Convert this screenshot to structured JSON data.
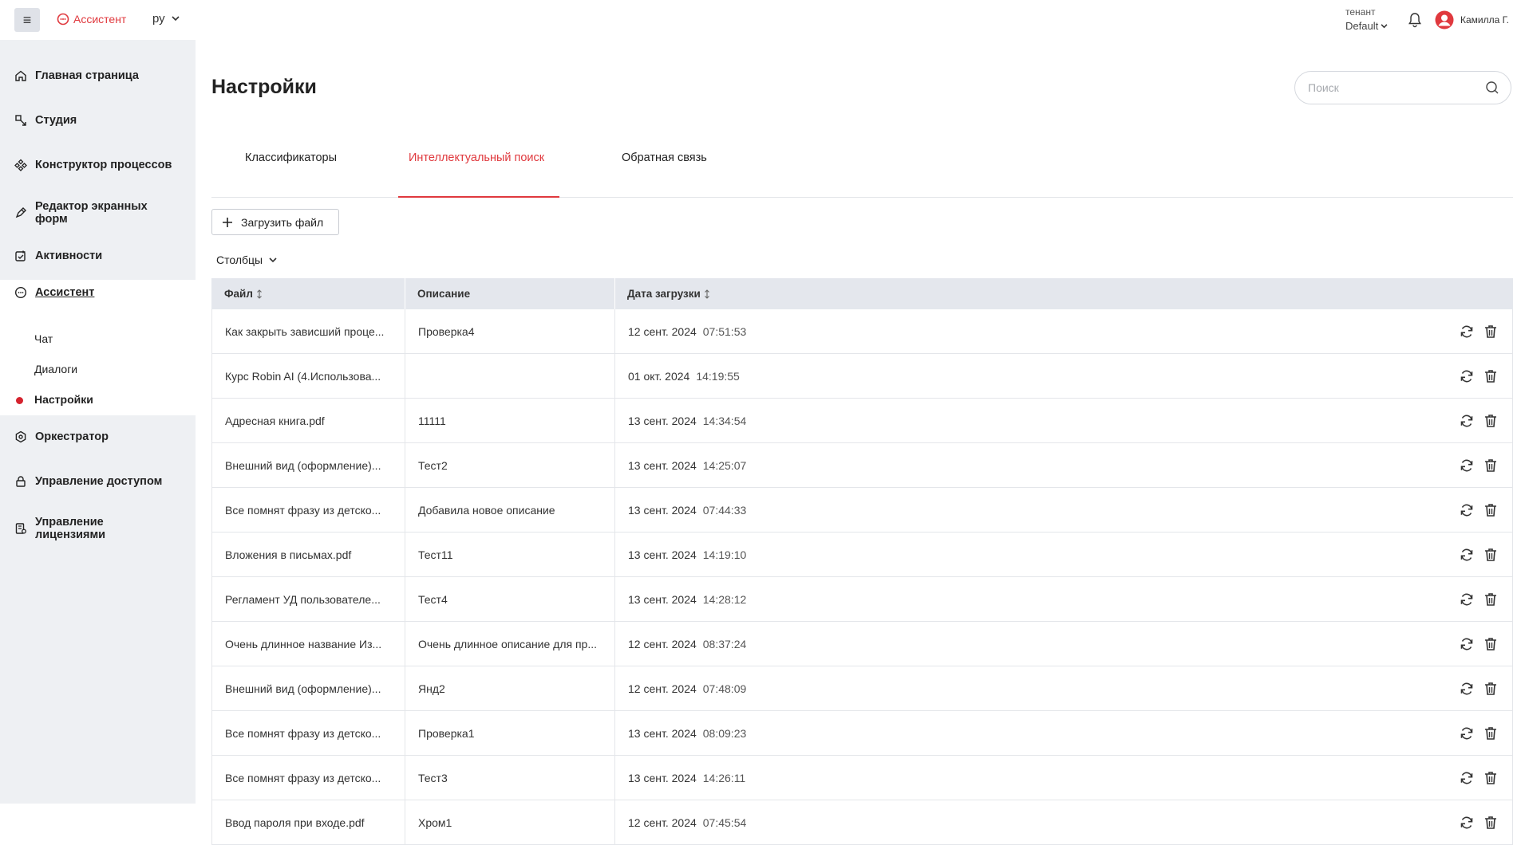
{
  "header": {
    "brand": "Ассистент",
    "language": "ру",
    "tenant_label": "тенант",
    "tenant_value": "Default",
    "user_name": "Камилла Г."
  },
  "sidebar": {
    "items": [
      {
        "label": "Главная страница",
        "icon": "home-icon"
      },
      {
        "label": "Студия",
        "icon": "studio-icon"
      },
      {
        "label": "Конструктор процессов",
        "icon": "process-icon"
      },
      {
        "label": "Редактор экранных форм",
        "icon": "form-editor-icon"
      },
      {
        "label": "Активности",
        "icon": "activity-icon"
      },
      {
        "label": "Ассистент",
        "icon": "assistant-icon"
      },
      {
        "label": "Оркестратор",
        "icon": "orchestrator-icon"
      },
      {
        "label": "Управление доступом",
        "icon": "access-icon"
      },
      {
        "label": "Управление лицензиями",
        "icon": "license-icon"
      }
    ],
    "form_editor_line1": "Редактор экранных",
    "form_editor_line2": "форм",
    "license_line1": "Управление",
    "license_line2": "лицензиями",
    "sub_items": [
      {
        "label": "Чат"
      },
      {
        "label": "Диалоги"
      },
      {
        "label": "Настройки"
      }
    ]
  },
  "main": {
    "title": "Настройки",
    "search_placeholder": "Поиск",
    "tabs": [
      {
        "label": "Классификаторы"
      },
      {
        "label": "Интеллектуальный поиск"
      },
      {
        "label": "Обратная связь"
      }
    ],
    "upload_label": "Загрузить файл",
    "columns_label": "Столбцы"
  },
  "table": {
    "headers": {
      "file": "Файл",
      "description": "Описание",
      "date": "Дата загрузки"
    },
    "rows": [
      {
        "file": "Как закрыть зависший проце...",
        "description": "Проверка4",
        "date": "12 сент. 2024",
        "time": "07:51:53"
      },
      {
        "file": "Курс Robin AI (4.Использова...",
        "description": "",
        "date": "01 окт. 2024",
        "time": "14:19:55"
      },
      {
        "file": "Адресная книга.pdf",
        "description": "11111",
        "date": "13 сент. 2024",
        "time": "14:34:54"
      },
      {
        "file": "Внешний вид (оформление)...",
        "description": "Тест2",
        "date": "13 сент. 2024",
        "time": "14:25:07"
      },
      {
        "file": "Все помнят фразу из детско...",
        "description": "Добавила новое описание",
        "date": "13 сент. 2024",
        "time": "07:44:33"
      },
      {
        "file": "Вложения в письмах.pdf",
        "description": "Тест11",
        "date": "13 сент. 2024",
        "time": "14:19:10"
      },
      {
        "file": "Регламент УД пользователе...",
        "description": "Тест4",
        "date": "13 сент. 2024",
        "time": "14:28:12"
      },
      {
        "file": "Очень длинное название Из...",
        "description": "Очень длинное описание для пр...",
        "date": "12 сент. 2024",
        "time": "08:37:24"
      },
      {
        "file": "Внешний вид (оформление)...",
        "description": "Янд2",
        "date": "12 сент. 2024",
        "time": "07:48:09"
      },
      {
        "file": "Все помнят фразу из детско...",
        "description": "Проверка1",
        "date": "13 сент. 2024",
        "time": "08:09:23"
      },
      {
        "file": "Все помнят фразу из детско...",
        "description": "Тест3",
        "date": "13 сент. 2024",
        "time": "14:26:11"
      },
      {
        "file": "Ввод пароля при входе.pdf",
        "description": "Хром1",
        "date": "12 сент. 2024",
        "time": "07:45:54"
      }
    ]
  },
  "colors": {
    "accent": "#e0393e",
    "sidebar_bg": "#eef0f3",
    "table_header_bg": "#e4e7ed"
  }
}
